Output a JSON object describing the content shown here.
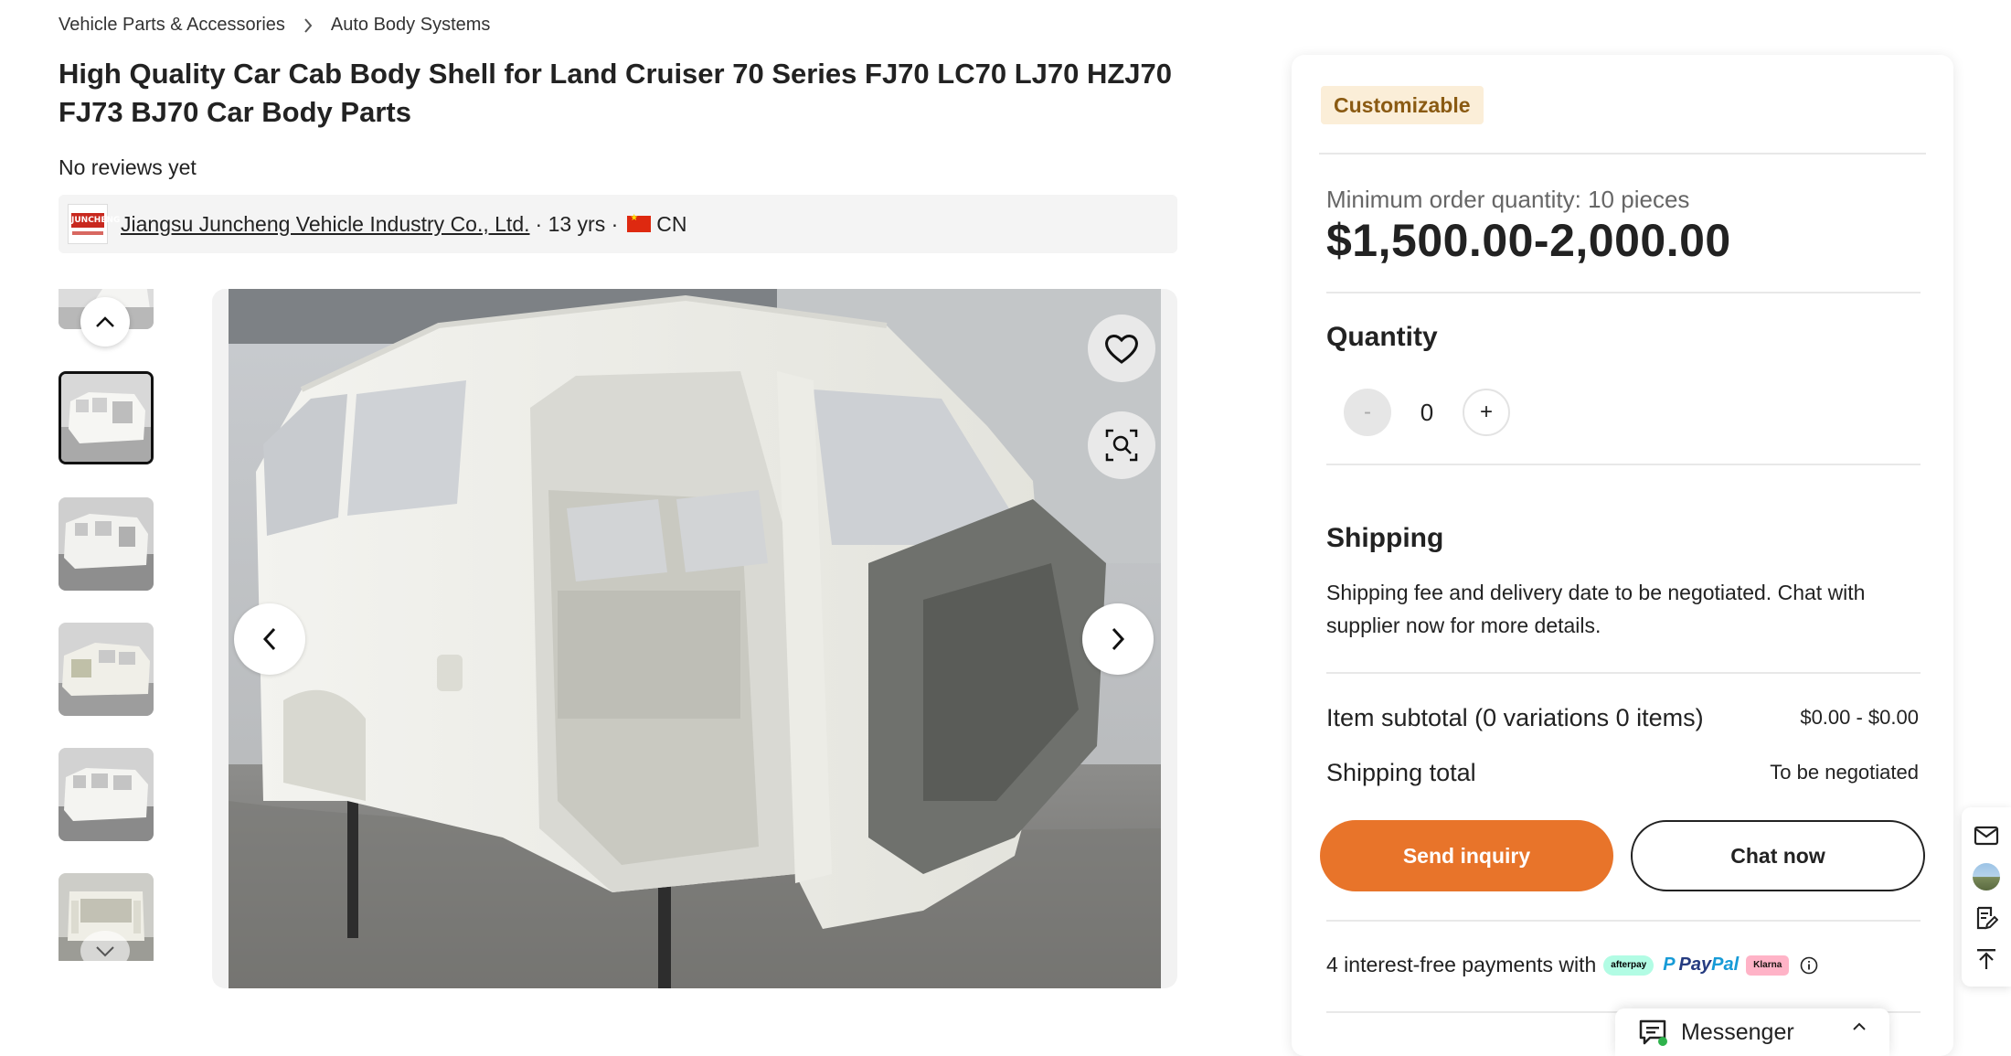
{
  "breadcrumb": {
    "items": [
      "Vehicle Parts & Accessories",
      "Auto Body Systems"
    ]
  },
  "product": {
    "title": "High Quality Car Cab Body Shell for Land Cruiser 70 Series FJ70 LC70 LJ70 HZJ70 FJ73 BJ70 Car Body Parts",
    "reviews": "No reviews yet"
  },
  "supplier": {
    "name": "Jiangsu Juncheng Vehicle Industry Co., Ltd.",
    "years": "· 13 yrs ·",
    "country": "CN",
    "logo_text": "JUNCHENG"
  },
  "gallery": {
    "thumbnail_count": 6,
    "active_index": 1
  },
  "panel": {
    "badge": "Customizable",
    "moq": "Minimum order quantity: 10 pieces",
    "price": "$1,500.00-2,000.00",
    "quantity_label": "Quantity",
    "quantity_value": "0",
    "minus_label": "-",
    "plus_label": "+",
    "shipping_title": "Shipping",
    "shipping_desc": "Shipping fee and delivery date to be negotiated. Chat with supplier now for more details.",
    "subtotal_label": "Item subtotal (0 variations 0 items)",
    "subtotal_value": "$0.00 - $0.00",
    "shipping_total_label": "Shipping total",
    "shipping_total_value": "To be negotiated",
    "send_inquiry": "Send inquiry",
    "chat_now": "Chat now",
    "payments_text": "4 interest-free payments with",
    "afterpay": "afterpay",
    "paypal_a": "Pay",
    "paypal_b": "Pal",
    "klarna": "Klarna"
  },
  "messenger": {
    "label": "Messenger"
  },
  "colors": {
    "accent_orange": "#e8742a",
    "badge_bg": "#fbeed8",
    "badge_text": "#8a5a12"
  }
}
